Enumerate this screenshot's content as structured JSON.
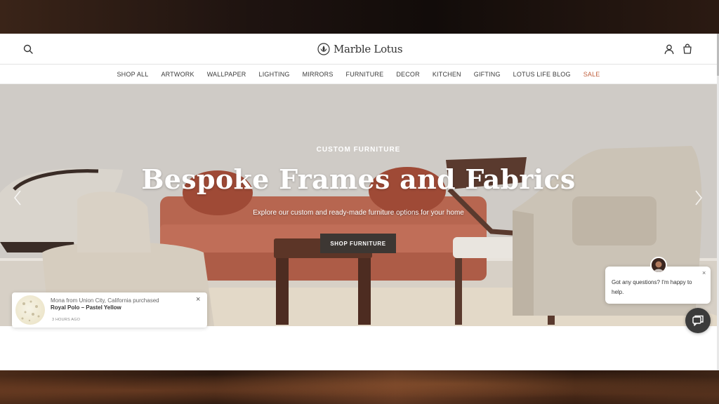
{
  "header": {
    "brand": "Marble Lotus",
    "search_icon": "search-icon",
    "account_icon": "account-icon",
    "cart_icon": "cart-icon"
  },
  "nav": {
    "items": [
      {
        "label": "SHOP ALL"
      },
      {
        "label": "ARTWORK"
      },
      {
        "label": "WALLPAPER"
      },
      {
        "label": "LIGHTING"
      },
      {
        "label": "MIRRORS"
      },
      {
        "label": "FURNITURE"
      },
      {
        "label": "DECOR"
      },
      {
        "label": "KITCHEN"
      },
      {
        "label": "GIFTING"
      },
      {
        "label": "LOTUS LIFE BLOG"
      },
      {
        "label": "SALE"
      }
    ],
    "sale_color": "#c0603e"
  },
  "hero": {
    "eyebrow": "CUSTOM FURNITURE",
    "title": "Bespoke Frames and Fabrics",
    "subtitle": "Explore our custom and ready-made furniture options for your home",
    "button_label": "SHOP FURNITURE",
    "button_color": "#3d3733"
  },
  "purchase_popup": {
    "line1": "Mona from Union City, California purchased",
    "product": "Royal Polo – Pastel Yellow",
    "time": "3 HOURS AGO",
    "close": "×"
  },
  "chat": {
    "message": "Got any questions? I'm happy to help.",
    "close": "×",
    "launcher_icon": "chat-icon"
  }
}
